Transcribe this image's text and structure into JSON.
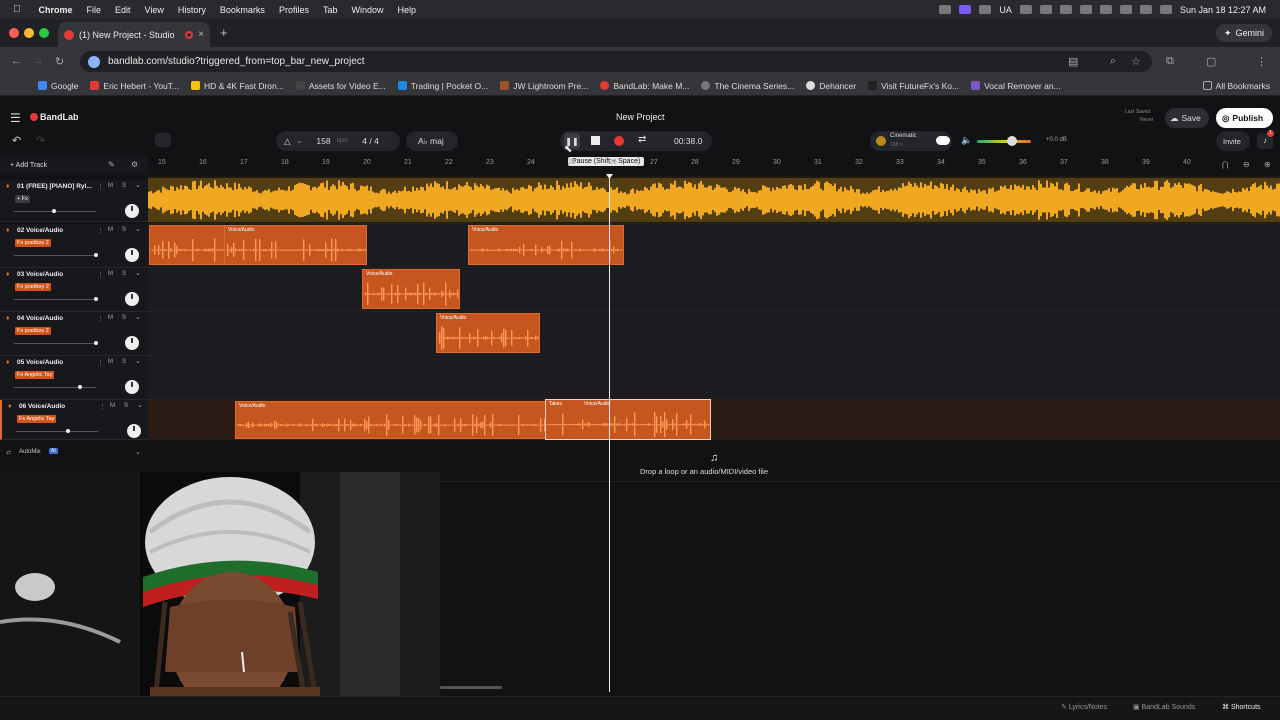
{
  "menubar": {
    "app": "Chrome",
    "items": [
      "File",
      "Edit",
      "View",
      "History",
      "Bookmarks",
      "Profiles",
      "Tab",
      "Window",
      "Help"
    ],
    "lang": "UA",
    "clock": "Sun Jan 18  12:27 AM"
  },
  "browser": {
    "tab_title": "(1) New Project - Studio",
    "gemini": "Gemini",
    "url": "bandlab.com/studio?triggered_from=top_bar_new_project",
    "bookmarks": [
      "Google",
      "Eric Hebert - YouT...",
      "HD & 4K Fast Dron...",
      "Assets for Video E...",
      "Trading | Pocket O...",
      "JW Lightroom Pre...",
      "BandLab: Make M...",
      "The Cinema Series...",
      "Dehancer",
      "Visit FutureFx's Ko...",
      "Vocal Remover an..."
    ],
    "all_bookmarks": "All Bookmarks"
  },
  "studio": {
    "logo": "BandLab",
    "project_title": "New Project",
    "last_saved_label": "Last Saved",
    "last_saved_value": "Never",
    "save": "Save",
    "publish": "Publish",
    "bpm_value": "158",
    "bpm_unit": "bpm",
    "time_sig": "4 / 4",
    "key": "A♭ maj",
    "time": "00:38.0",
    "tooltip": "Pause (Shift + Space)",
    "cinematic": "Cinematic",
    "cinematic_sub": "138 >",
    "volume_db": "+0.0 dB",
    "invite": "Invite",
    "notification_count": "1",
    "add_track": "Add Track",
    "automix": "AutoMix",
    "automix_badge": "AI",
    "drop_hint": "Drop a loop or an audio/MIDI/video file",
    "ruler": [
      "15",
      "16",
      "17",
      "18",
      "19",
      "20",
      "21",
      "22",
      "23",
      "24",
      "25",
      "26",
      "27",
      "28",
      "29",
      "30",
      "31",
      "32",
      "33",
      "34",
      "35",
      "36",
      "37",
      "38",
      "39",
      "40"
    ],
    "tracks": [
      {
        "name": "01  (FREE) [PIANO] Ryl...",
        "fx": "+ Fx",
        "vol": 0.48
      },
      {
        "name": "02  Voice/Audio",
        "fx": "Fx  poetboy 2",
        "vol": 1.0
      },
      {
        "name": "03  Voice/Audio",
        "fx": "Fx  poetboy 2",
        "vol": 1.0
      },
      {
        "name": "04  Voice/Audio",
        "fx": "Fx  poetboy 2",
        "vol": 1.0
      },
      {
        "name": "05  Voice/Audio",
        "fx": "Fx  Angelic Tay",
        "vol": 0.8
      },
      {
        "name": "06  Voice/Audio",
        "fx": "Fx  Angelic Tay",
        "vol": 0.62
      }
    ],
    "clip_label": "Voice/Audio",
    "take_label": "Takes",
    "bottom": {
      "lyrics": "Lyrics/Notes",
      "sounds": "BandLab Sounds",
      "shortcuts": "Shortcuts"
    }
  },
  "colors": {
    "accent": "#e46a2a",
    "piano_wave": "#f0a821",
    "bg": "#111214"
  }
}
